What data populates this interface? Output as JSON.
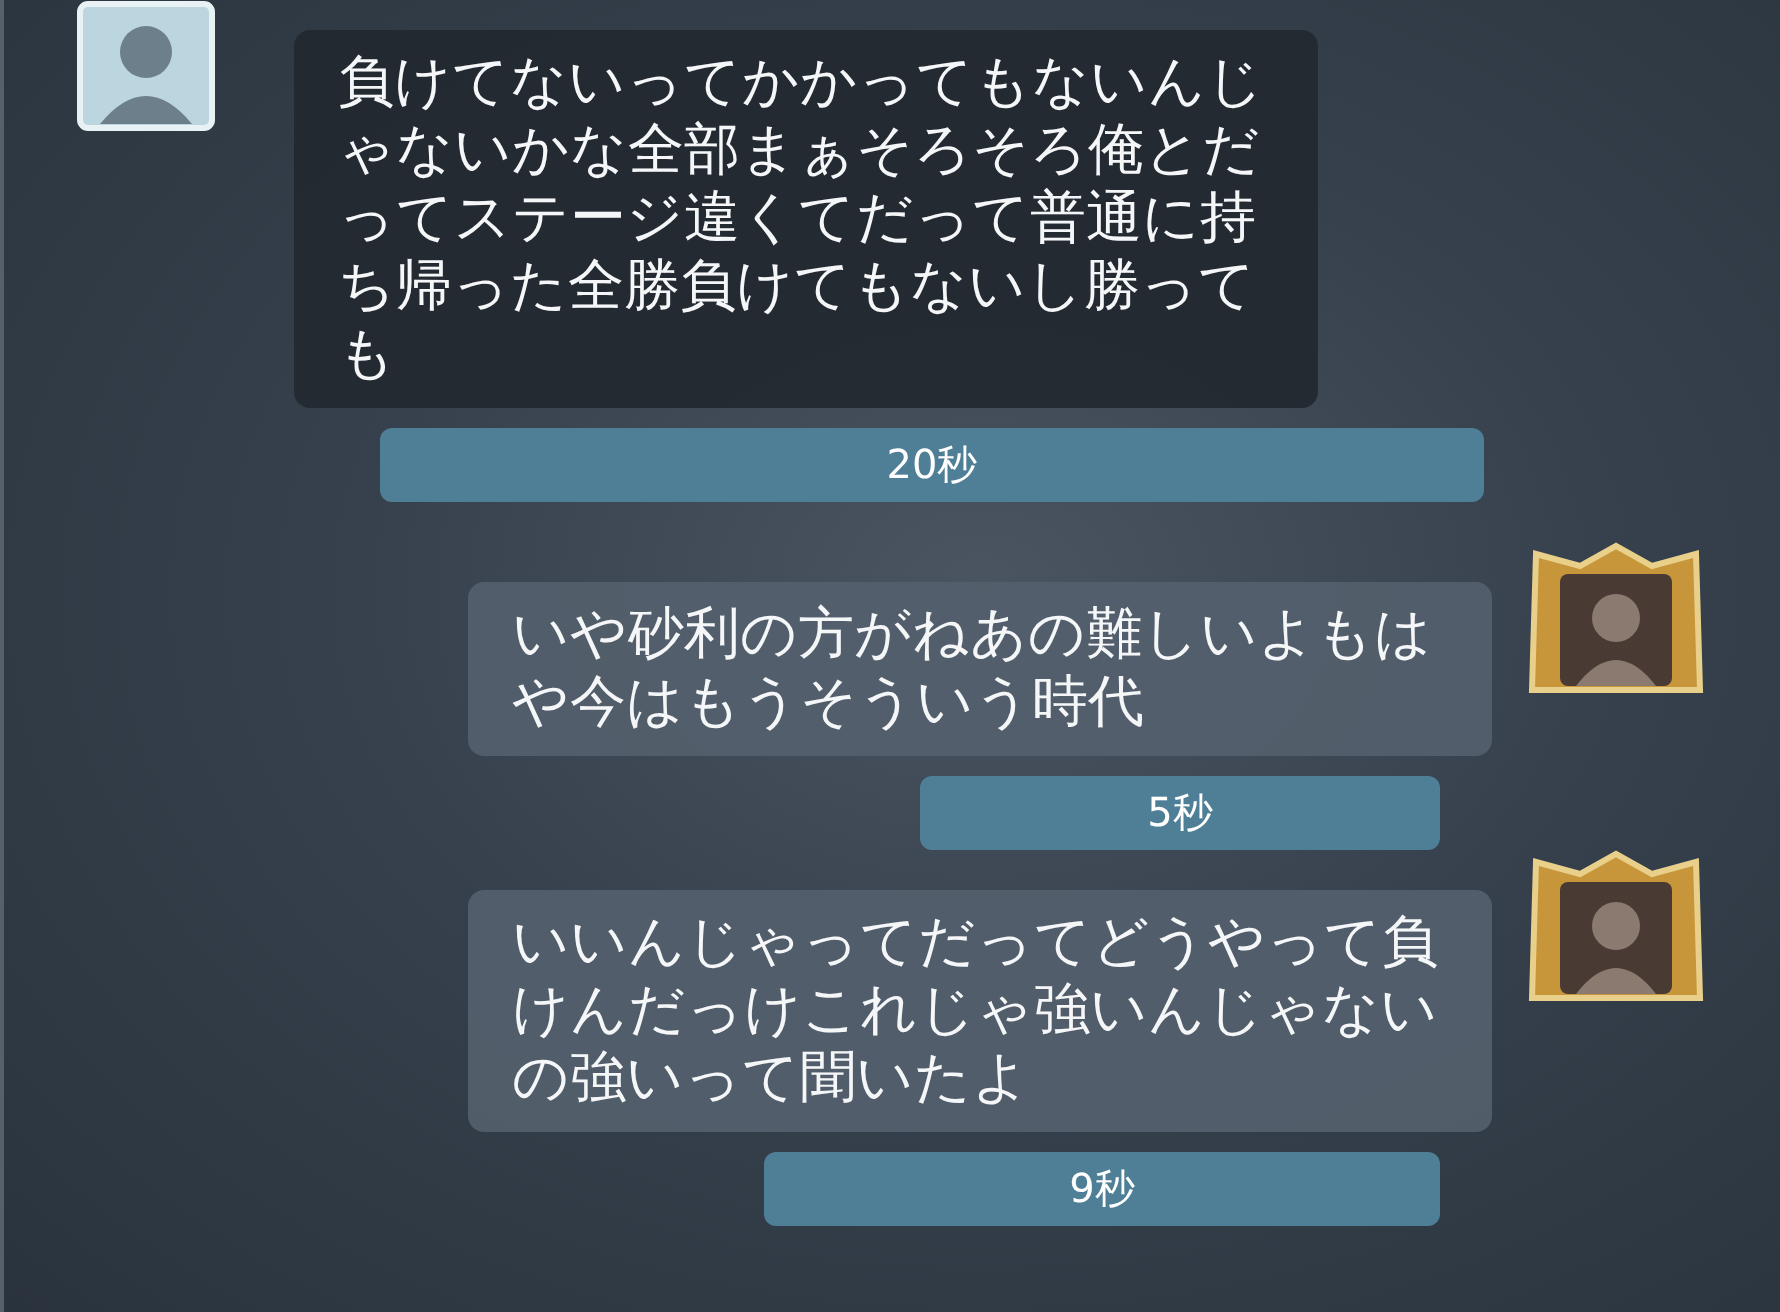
{
  "messages": [
    {
      "kind": "received",
      "text": "負けてないってかかってもないんじゃないかな全部まぁそろそろ俺とだってステージ違くてだって普通に持ち帰った全勝負けてもないし勝っても",
      "time": "20秒"
    },
    {
      "kind": "sent",
      "text": "いや砂利の方がねあの難しいよもはや今はもうそういう時代",
      "time": "5秒"
    },
    {
      "kind": "sent",
      "text": "いいんじゃってだってどうやって負けんだっけこれじゃ強いんじゃないの強いって聞いたよ",
      "time": "9秒"
    }
  ]
}
